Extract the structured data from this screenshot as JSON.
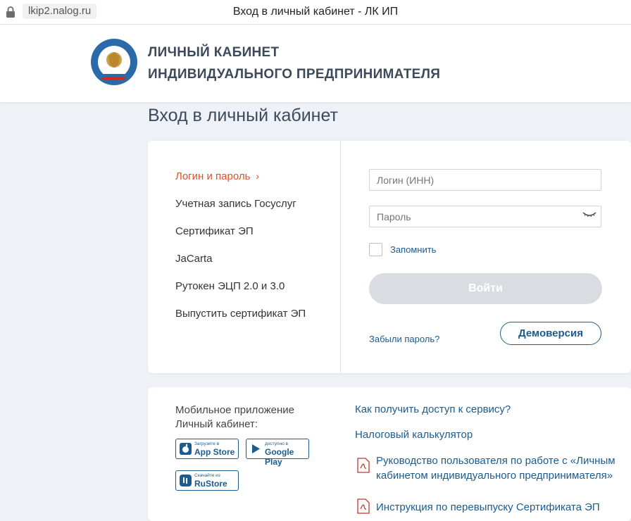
{
  "browser": {
    "url": "lkip2.nalog.ru",
    "title": "Вход в личный кабинет - ЛК ИП"
  },
  "header": {
    "brand_line1": "ЛИЧНЫЙ КАБИНЕТ",
    "brand_line2": "ИНДИВИДУАЛЬНОГО ПРЕДПРИНИМАТЕЛЯ"
  },
  "page": {
    "heading": "Вход в личный кабинет"
  },
  "login_methods": [
    {
      "label": "Логин и пароль",
      "active": true
    },
    {
      "label": "Учетная запись Госуслуг"
    },
    {
      "label": "Сертификат ЭП"
    },
    {
      "label": "JaCarta"
    },
    {
      "label": "Рутокен ЭЦП 2.0 и 3.0"
    },
    {
      "label": "Выпустить сертификат ЭП"
    }
  ],
  "form": {
    "login_placeholder": "Логин (ИНН)",
    "password_placeholder": "Пароль",
    "remember_label": "Запомнить",
    "submit_label": "Войти",
    "forgot_label": "Забыли пароль?",
    "demo_label": "Демоверсия"
  },
  "apps": {
    "title_line1": "Мобильное приложение",
    "title_line2": "Личный кабинет:",
    "appstore_small": "Загрузите в",
    "appstore_big": "App Store",
    "gplay_small": "доступно в",
    "gplay_big": "Google Play",
    "rustore_small": "Скачайте из",
    "rustore_big": "RuStore"
  },
  "links": {
    "access": "Как получить доступ к сервису?",
    "calculator": "Налоговый калькулятор",
    "manual": "Руководство пользователя по работе с «Личным кабинетом индивидуального предпринимателя»",
    "reissue": "Инструкция по перевыпуску Сертификата ЭП"
  },
  "colors": {
    "accent_orange": "#d9532b",
    "link_blue": "#1b5b8f",
    "heading_gray": "#3d4a5c",
    "background": "#eef2f7",
    "disabled_button": "#d9dde2"
  }
}
